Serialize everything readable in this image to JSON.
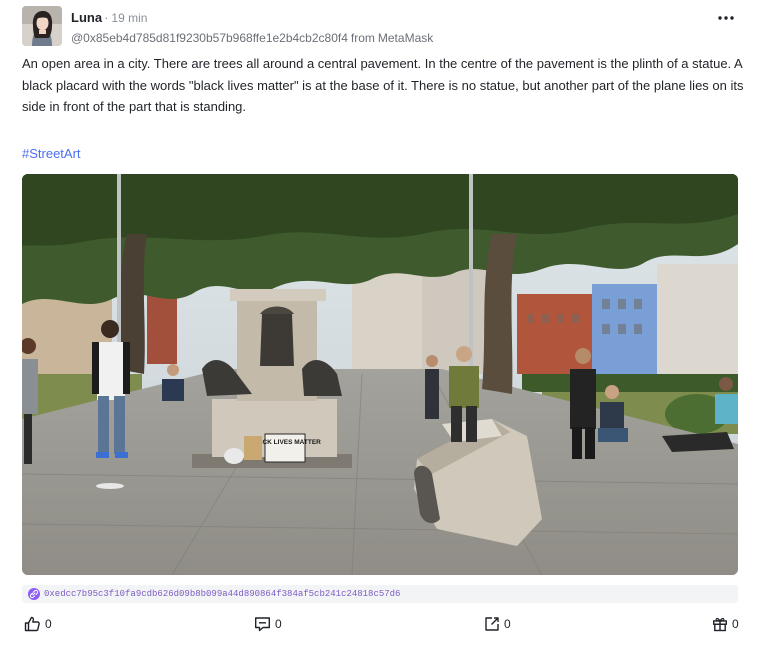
{
  "post": {
    "author_name": "Luna",
    "separator": "·",
    "time_ago": "19 min",
    "address": "@0x85eb4d785d81f9230b57b968ffe1e2b4cb2c80f4",
    "from_label": "from",
    "source": "MetaMask",
    "text": "An open area in a city. There are trees all around a central pavement. In the centre of the pavement is the plinth of a statue. A black placard with the words \"black lives matter\" is at the base of it. There is no statue, but another part of the plane lies on its side in front of the part that is standing.",
    "hashtag": "#StreetArt",
    "placard_text": "BLACK LIVES MATTER",
    "tx_hash": "0xedcc7b95c3f10fa9cdb626d09b8b099a44d890864f384af5cb241c24818c57d6"
  },
  "actions": {
    "like_count": "0",
    "comment_count": "0",
    "share_count": "0",
    "collect_count": "0"
  },
  "icons": {
    "more": "more-horizontal-icon",
    "hash": "link-chain-icon",
    "like": "thumbs-up-icon",
    "comment": "comment-icon",
    "share": "share-icon",
    "collect": "gift-icon"
  },
  "colors": {
    "hashtag": "#4c6ef5",
    "hash_text": "#7c5cc4",
    "hash_bar": "#f3f4f6"
  }
}
